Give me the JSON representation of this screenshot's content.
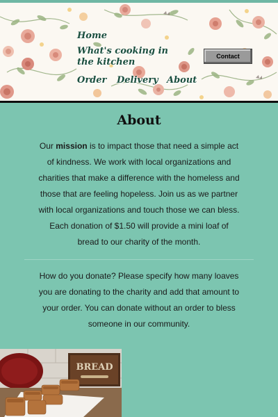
{
  "nav": {
    "home": "Home",
    "whats_cooking": "What's cooking in the kitchen",
    "order": "Order",
    "delivery": "Delivery",
    "about": "About",
    "contact": "Contact"
  },
  "main": {
    "title": "About",
    "mission_intro": "Our ",
    "mission_word": "mission",
    "mission_text": " is to impact those that need a simple act of kindness. We work with local organizations and charities that make a difference with the homeless and those that are feeling hopeless. Join us as we partner with local organizations and touch those we can bless. Each donation of $1.50 will provide a mini loaf of bread to our charity of the month.",
    "donate_text": "How do you donate? Please specify how many loaves you are donating to the charity and add that amount to your order. You can donate without an order to bless someone in our community."
  },
  "photo": {
    "sign_text": "BREAD"
  },
  "colors": {
    "background": "#7cc5b0",
    "nav_text": "#1b4f3f",
    "header_background": "#fbf8f2"
  }
}
